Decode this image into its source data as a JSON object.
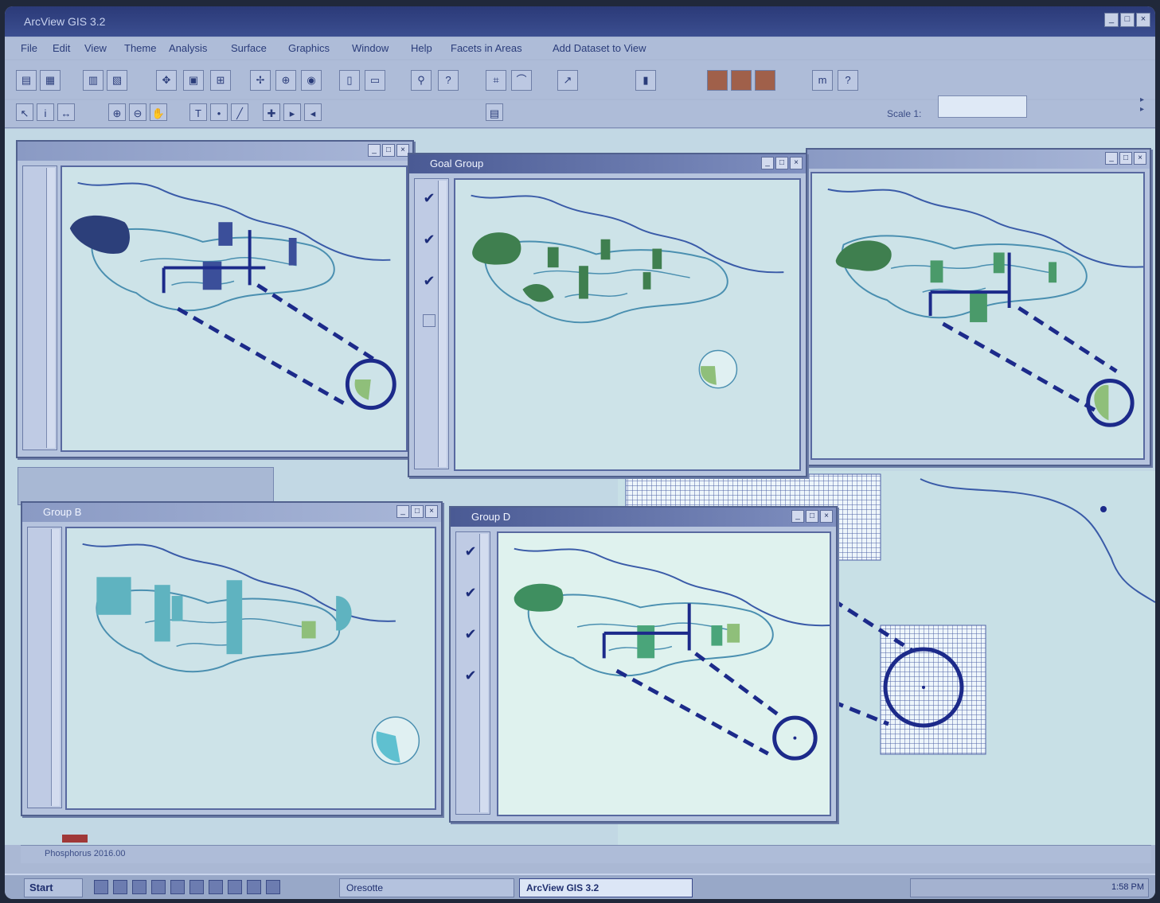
{
  "app": {
    "title": "ArcView GIS 3.2"
  },
  "menu": {
    "items": [
      "File",
      "Edit",
      "View",
      "Theme",
      "Analysis",
      "Surface",
      "Graphics",
      "Window",
      "Help",
      "Facets in Areas",
      "Add Dataset to View"
    ]
  },
  "toolbar": {
    "scale_label": "Scale 1:",
    "scale_value": ""
  },
  "windows": {
    "top_middle": {
      "title": "Goal Group",
      "checks": [
        "✔",
        "✔",
        "✔",
        ""
      ]
    },
    "bottom_left": {
      "title": "Group B"
    },
    "bottom_right": {
      "title": "Group D",
      "checks": [
        "✔",
        "✔",
        "✔",
        "✔"
      ]
    }
  },
  "status": {
    "text": "Phosphorus 2016.00"
  },
  "taskbar": {
    "start": "Start",
    "items": [
      {
        "label": "Oresotte"
      },
      {
        "label": "ArcView GIS 3.2"
      }
    ],
    "clock": "1:58 PM"
  },
  "colors": {
    "map_bg": "#cde3e8",
    "dark_green": "#3f7f4f",
    "teal": "#5fbcc8",
    "navy": "#1c2a8a"
  },
  "icons": [
    "check-icon",
    "minimize-icon",
    "maximize-icon",
    "close-icon",
    "tool-icon",
    "help-icon"
  ]
}
